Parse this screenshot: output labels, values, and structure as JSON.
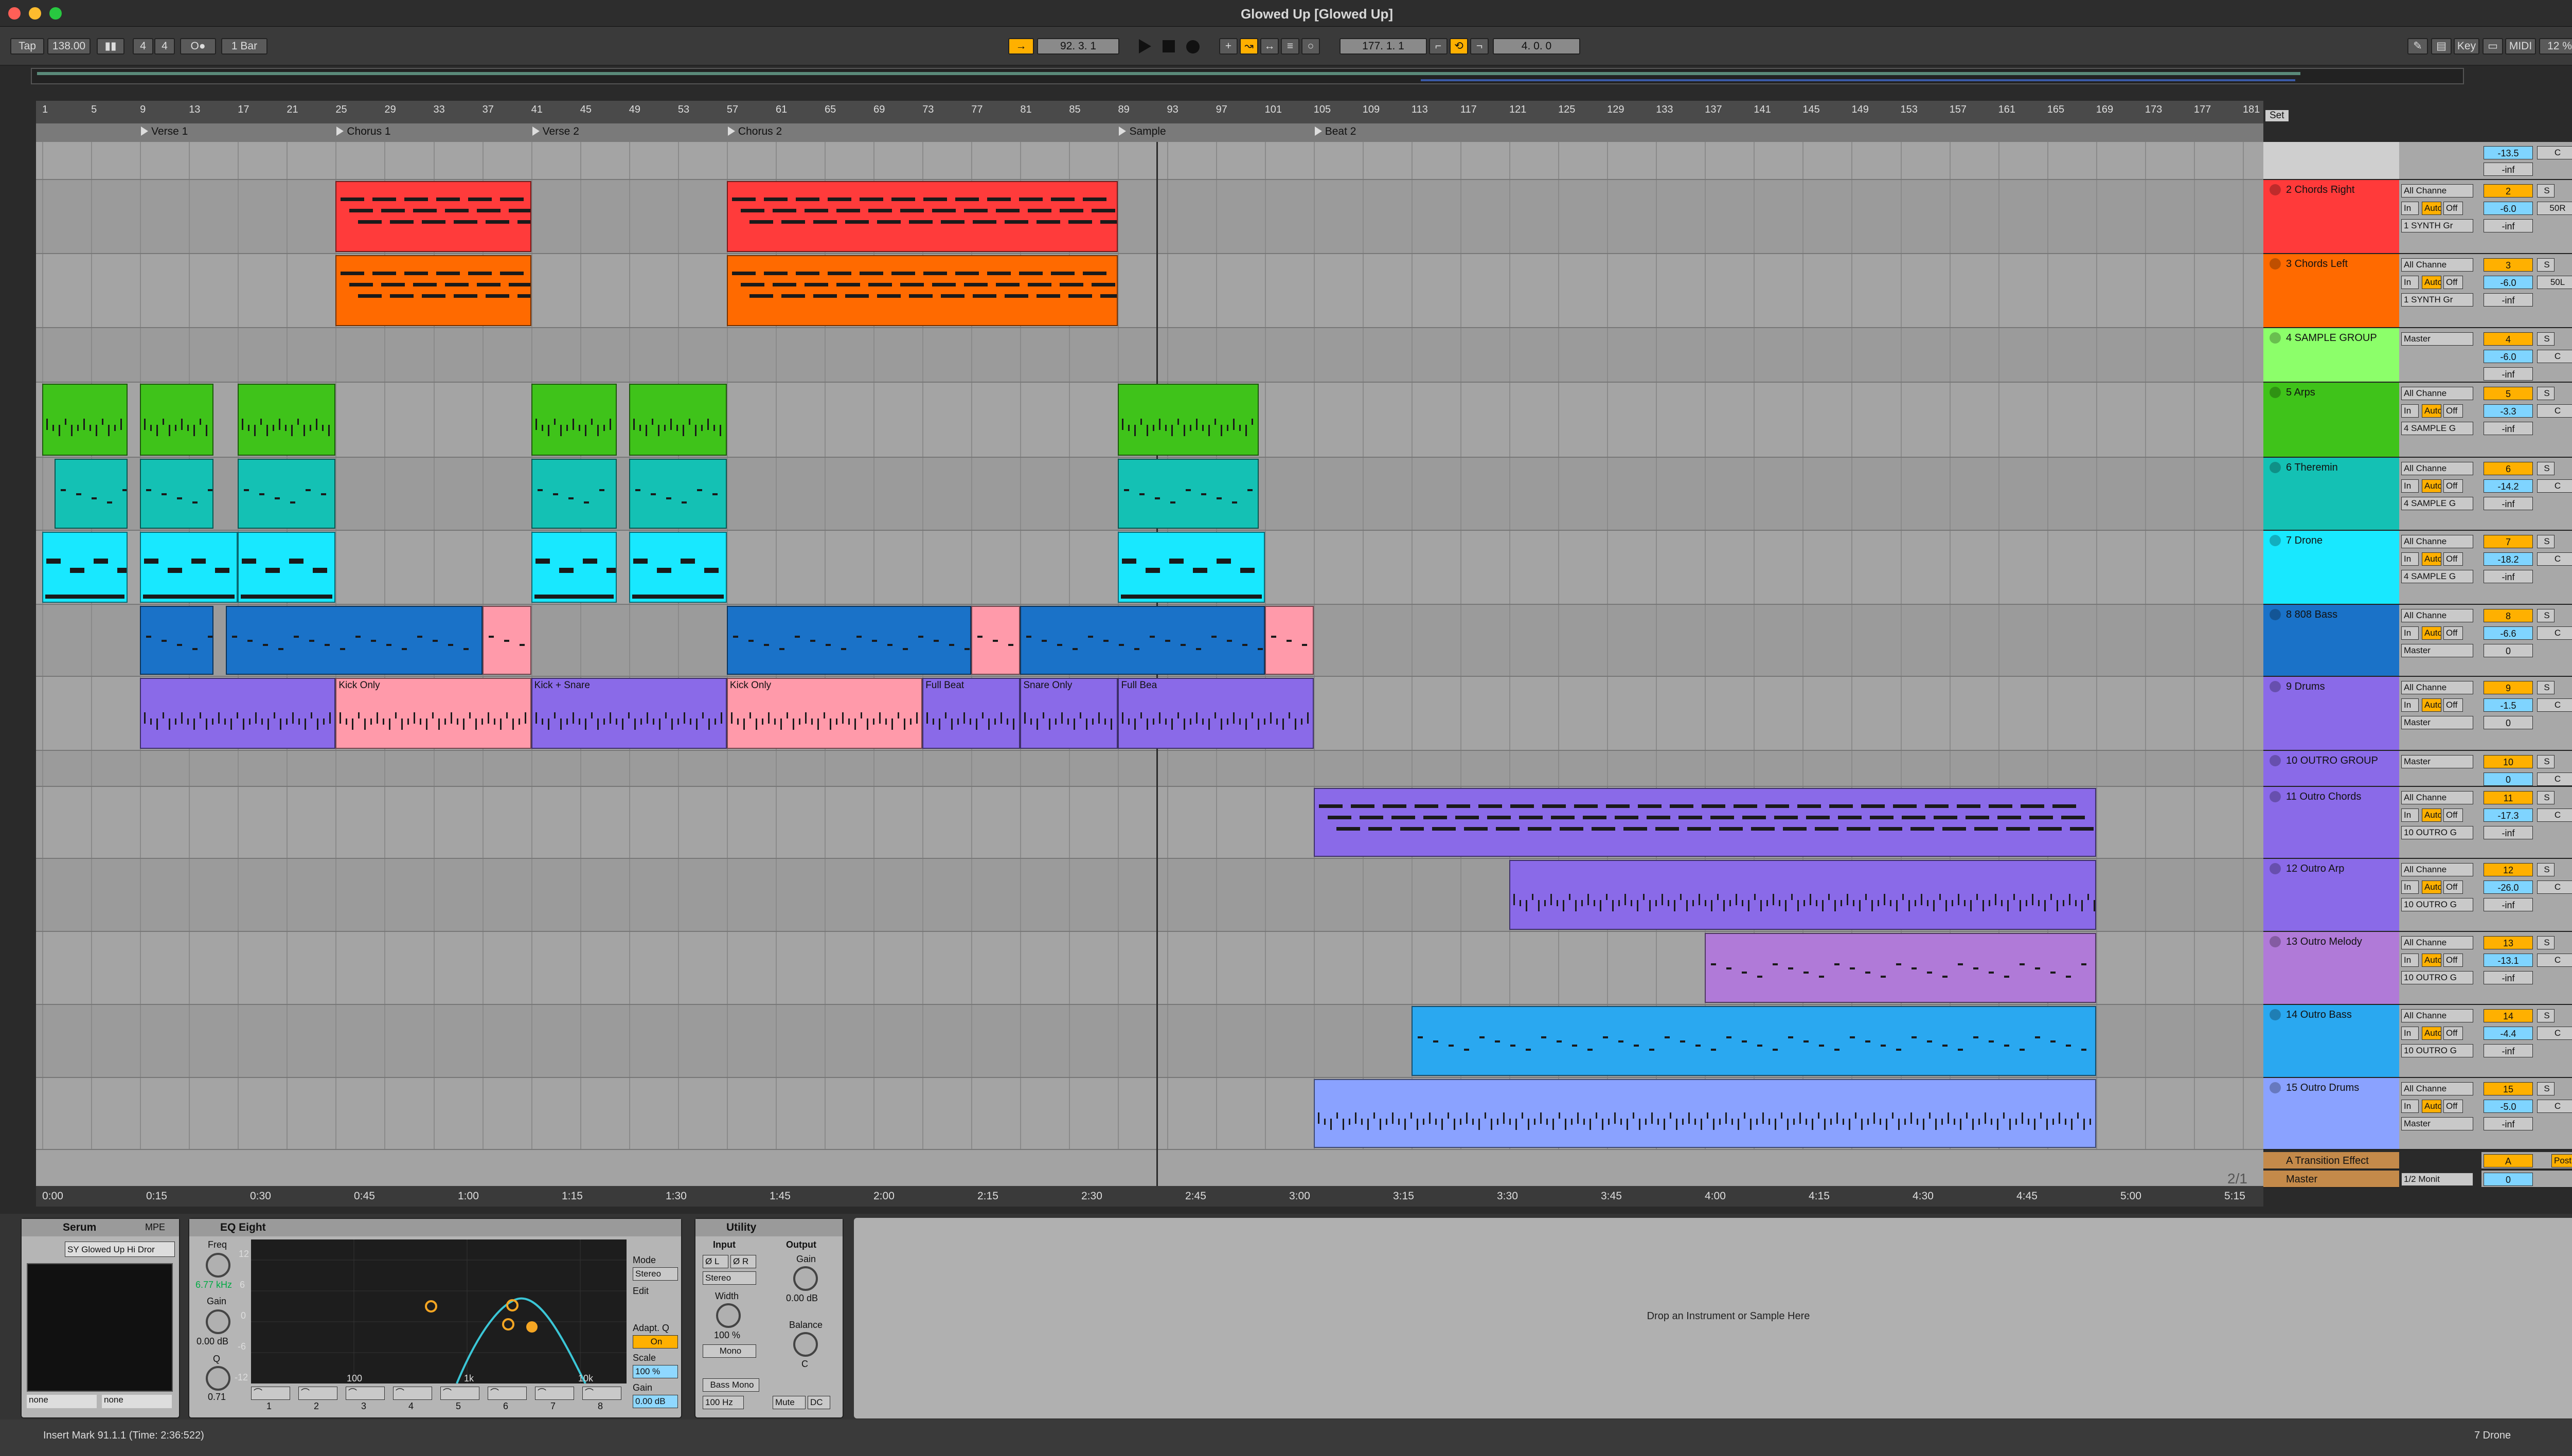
{
  "window": {
    "title": "Glowed Up  [Glowed Up]"
  },
  "transport": {
    "tap": "Tap",
    "tempo": "138.00",
    "sig_num": "4",
    "sig_den": "4",
    "quant": "1 Bar",
    "position": "92.   3.   1",
    "loop_start": "177.   1.   1",
    "loop_len": "4.   0.   0"
  },
  "control_right": {
    "key": "Key",
    "midi": "MIDI",
    "cpu": "12 %"
  },
  "ruler_bars": [
    "1",
    "5",
    "9",
    "13",
    "17",
    "21",
    "25",
    "29",
    "33",
    "37",
    "41",
    "45",
    "49",
    "53",
    "57",
    "61",
    "65",
    "69",
    "73",
    "77",
    "81",
    "85",
    "89",
    "93",
    "97",
    "101",
    "105",
    "109",
    "113",
    "117",
    "121",
    "125",
    "129",
    "133",
    "137",
    "141",
    "145",
    "149",
    "153",
    "157",
    "161",
    "165",
    "169",
    "173",
    "177",
    "181"
  ],
  "locators": [
    "Verse 1",
    "Chorus 1",
    "Verse 2",
    "Chorus 2",
    "Sample",
    "Beat 2"
  ],
  "set_label": "Set",
  "tracks": [
    {
      "name": "",
      "color": "#cfcfcf",
      "vol": "-13.5",
      "pan": "C",
      "inf": "-inf",
      "io1": "",
      "io2": "",
      "io3": "",
      "num": ""
    },
    {
      "name": "2 Chords Right",
      "color": "#ff3a3a",
      "vol": "-6.0",
      "pan": "50R",
      "inf": "-inf",
      "io1": "All Channe",
      "io2": "1 SYNTH Gr",
      "num": "2"
    },
    {
      "name": "3 Chords Left",
      "color": "#ff6a00",
      "vol": "-6.0",
      "pan": "50L",
      "inf": "-inf",
      "io1": "All Channe",
      "io2": "1 SYNTH Gr",
      "num": "3"
    },
    {
      "name": "4 SAMPLE GROUP",
      "color": "#8cff6a",
      "vol": "-6.0",
      "pan": "C",
      "inf": "-inf",
      "io1": "Master",
      "io2": "",
      "num": "4"
    },
    {
      "name": "5 Arps",
      "color": "#3fc31a",
      "vol": "-3.3",
      "pan": "C",
      "inf": "-inf",
      "io1": "All Channe",
      "io2": "4 SAMPLE G",
      "num": "5"
    },
    {
      "name": "6 Theremin",
      "color": "#14c1b4",
      "vol": "-14.2",
      "pan": "C",
      "inf": "-inf",
      "io1": "All Channe",
      "io2": "4 SAMPLE G",
      "num": "6"
    },
    {
      "name": "7 Drone",
      "color": "#18e8ff",
      "vol": "-18.2",
      "pan": "C",
      "inf": "-inf",
      "io1": "All Channe",
      "io2": "4 SAMPLE G",
      "num": "7"
    },
    {
      "name": "8 808 Bass",
      "color": "#1a72c8",
      "vol": "-6.6",
      "pan": "C",
      "inf": "0",
      "io1": "All Channe",
      "io2": "Master",
      "num": "8"
    },
    {
      "name": "9 Drums",
      "color": "#8a6ae8",
      "vol": "-1.5",
      "pan": "C",
      "inf": "0",
      "io1": "All Channe",
      "io2": "Master",
      "num": "9"
    },
    {
      "name": "10 OUTRO GROUP",
      "color": "#8a6ae8",
      "vol": "0",
      "pan": "C",
      "inf": "",
      "io1": "Master",
      "io2": "",
      "num": "10"
    },
    {
      "name": "11 Outro Chords",
      "color": "#8a6ae8",
      "vol": "-17.3",
      "pan": "C",
      "inf": "-inf",
      "io1": "All Channe",
      "io2": "10 OUTRO G",
      "num": "11"
    },
    {
      "name": "12 Outro Arp",
      "color": "#8a6ae8",
      "vol": "-26.0",
      "pan": "C",
      "inf": "-inf",
      "io1": "All Channe",
      "io2": "10 OUTRO G",
      "num": "12"
    },
    {
      "name": "13 Outro Melody",
      "color": "#b07ad8",
      "vol": "-13.1",
      "pan": "C",
      "inf": "-inf",
      "io1": "All Channe",
      "io2": "10 OUTRO G",
      "num": "13"
    },
    {
      "name": "14 Outro Bass",
      "color": "#2aa8f0",
      "vol": "-4.4",
      "pan": "C",
      "inf": "-inf",
      "io1": "All Channe",
      "io2": "10 OUTRO G",
      "num": "14"
    },
    {
      "name": "15 Outro Drums",
      "color": "#8aa2ff",
      "vol": "-5.0",
      "pan": "C",
      "inf": "-inf",
      "io1": "All Channe",
      "io2": "Master",
      "num": "15"
    }
  ],
  "returns": [
    {
      "name": "A Transition Effect",
      "num": "A",
      "post": "Post"
    },
    {
      "name": "Master",
      "num": "0",
      "route": "1/2 Monit"
    }
  ],
  "io_labels": {
    "in": "In",
    "auto": "Auto",
    "off": "Off",
    "s": "S"
  },
  "clip_names": {
    "kick_only": "Kick Only",
    "kick_snare": "Kick + Snare",
    "kick_only2": "Kick Only",
    "full_beat": "Full Beat",
    "snare_only": "Snare Only",
    "full_beat2": "Full Bea"
  },
  "time_marks": [
    "0:00",
    "0:15",
    "0:30",
    "0:45",
    "1:00",
    "1:15",
    "1:30",
    "1:45",
    "2:00",
    "2:15",
    "2:30",
    "2:45",
    "3:00",
    "3:15",
    "3:30",
    "3:45",
    "4:00",
    "4:15",
    "4:30",
    "4:45",
    "5:00",
    "5:15"
  ],
  "page_indicator": "2/1",
  "serum": {
    "title": "Serum",
    "mpe": "MPE",
    "preset": "SY Glowed Up Hi Dror",
    "none1": "none",
    "none2": "none"
  },
  "eq": {
    "title": "EQ Eight",
    "freq": "Freq",
    "freq_val": "6.77 kHz",
    "gain": "Gain",
    "gain_val": "0.00 dB",
    "q": "Q",
    "q_val": "0.71",
    "mode": "Mode",
    "mode_val": "Stereo",
    "edit": "Edit",
    "adapt": "Adapt. Q",
    "on": "On",
    "scale": "Scale",
    "scale_val": "100 %",
    "gain2": "Gain",
    "gain2_val": "0.00 dB",
    "y12": "12",
    "y6": "6",
    "y0": "0",
    "ym6": "-6",
    "ym12": "-12",
    "x100": "100",
    "x1k": "1k",
    "x10k": "10k",
    "bands": [
      "1",
      "2",
      "3",
      "4",
      "5",
      "6",
      "7",
      "8"
    ]
  },
  "utility": {
    "title": "Utility",
    "input": "Input",
    "output": "Output",
    "phl": "Ø L",
    "phr": "Ø R",
    "stereo": "Stereo",
    "width": "Width",
    "width_val": "100 %",
    "mono": "Mono",
    "bassmono": "Bass Mono",
    "hz": "100 Hz",
    "gain": "Gain",
    "gain_val": "0.00 dB",
    "balance": "Balance",
    "bal_val": "C",
    "mute": "Mute",
    "dc": "DC"
  },
  "drop_hint": "Drop an Instrument or Sample Here",
  "status": {
    "text": "Insert Mark 91.1.1 (Time: 2:36:522)",
    "track": "7 Drone"
  }
}
